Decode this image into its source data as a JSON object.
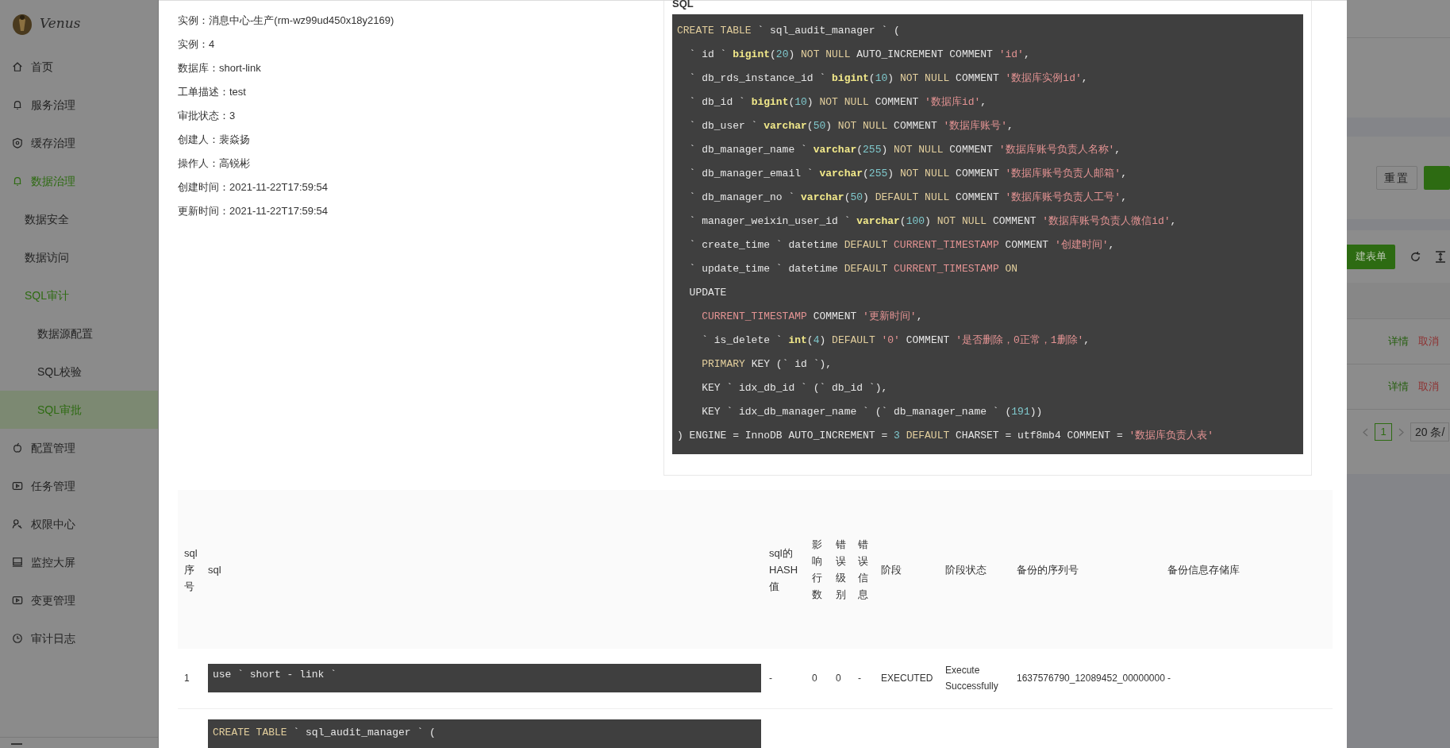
{
  "sidebar": {
    "logo_text": "Venus",
    "items": [
      {
        "label": "首页",
        "selected": false
      },
      {
        "label": "服务治理",
        "selected": false
      },
      {
        "label": "缓存治理",
        "selected": false
      },
      {
        "label": "数据治理",
        "selected": false,
        "expanded": true,
        "children": [
          {
            "label": "数据安全",
            "selected": false
          },
          {
            "label": "数据访问",
            "selected": false
          },
          {
            "label": "SQL审计",
            "selected": false,
            "expanded": true,
            "children": [
              {
                "label": "数据源配置",
                "selected": false
              },
              {
                "label": "SQL校验",
                "selected": false
              },
              {
                "label": "SQL审批",
                "selected": true
              }
            ]
          }
        ]
      },
      {
        "label": "配置管理",
        "selected": false
      },
      {
        "label": "任务管理",
        "selected": false
      },
      {
        "label": "权限中心",
        "selected": false
      },
      {
        "label": "监控大屏",
        "selected": false
      },
      {
        "label": "变更管理",
        "selected": false
      },
      {
        "label": "审计日志",
        "selected": false
      }
    ]
  },
  "modal": {
    "details": [
      "实例：消息中心-生产(rm-wz99ud450x18y2169)",
      "实例：4",
      "数据库：short-link",
      "工单描述：test",
      "审批状态：3",
      "创建人：裴焱扬",
      "操作人：高锐彬",
      "创建时间：2021-11-22T17:59:54",
      "更新时间：2021-11-22T17:59:54"
    ],
    "sql_card": {
      "title": "SQL",
      "lines": [
        [
          {
            "kind": "keyword",
            "text": "CREATE TABLE"
          },
          {
            "kind": "plain",
            "text": " ` sql_audit_manager ` ("
          }
        ],
        [
          {
            "kind": "plain",
            "text": "  ` id ` "
          },
          {
            "kind": "type",
            "text": "bigint"
          },
          {
            "kind": "plain",
            "text": "("
          },
          {
            "kind": "number",
            "text": "20"
          },
          {
            "kind": "plain",
            "text": ") "
          },
          {
            "kind": "keyword",
            "text": "NOT NULL"
          },
          {
            "kind": "plain",
            "text": " AUTO_INCREMENT COMMENT "
          },
          {
            "kind": "string",
            "text": "'id'"
          },
          {
            "kind": "plain",
            "text": ","
          }
        ],
        [
          {
            "kind": "plain",
            "text": "  ` db_rds_instance_id ` "
          },
          {
            "kind": "type",
            "text": "bigint"
          },
          {
            "kind": "plain",
            "text": "("
          },
          {
            "kind": "number",
            "text": "10"
          },
          {
            "kind": "plain",
            "text": ") "
          },
          {
            "kind": "keyword",
            "text": "NOT NULL"
          },
          {
            "kind": "plain",
            "text": " COMMENT "
          },
          {
            "kind": "string",
            "text": "'数据库实例id'"
          },
          {
            "kind": "plain",
            "text": ","
          }
        ],
        [
          {
            "kind": "plain",
            "text": "  ` db_id ` "
          },
          {
            "kind": "type",
            "text": "bigint"
          },
          {
            "kind": "plain",
            "text": "("
          },
          {
            "kind": "number",
            "text": "10"
          },
          {
            "kind": "plain",
            "text": ") "
          },
          {
            "kind": "keyword",
            "text": "NOT NULL"
          },
          {
            "kind": "plain",
            "text": " COMMENT "
          },
          {
            "kind": "string",
            "text": "'数据库id'"
          },
          {
            "kind": "plain",
            "text": ","
          }
        ],
        [
          {
            "kind": "plain",
            "text": "  ` db_user ` "
          },
          {
            "kind": "type",
            "text": "varchar"
          },
          {
            "kind": "plain",
            "text": "("
          },
          {
            "kind": "number",
            "text": "50"
          },
          {
            "kind": "plain",
            "text": ") "
          },
          {
            "kind": "keyword",
            "text": "NOT NULL"
          },
          {
            "kind": "plain",
            "text": " COMMENT "
          },
          {
            "kind": "string",
            "text": "'数据库账号'"
          },
          {
            "kind": "plain",
            "text": ","
          }
        ],
        [
          {
            "kind": "plain",
            "text": "  ` db_manager_name ` "
          },
          {
            "kind": "type",
            "text": "varchar"
          },
          {
            "kind": "plain",
            "text": "("
          },
          {
            "kind": "number",
            "text": "255"
          },
          {
            "kind": "plain",
            "text": ") "
          },
          {
            "kind": "keyword",
            "text": "NOT NULL"
          },
          {
            "kind": "plain",
            "text": " COMMENT "
          },
          {
            "kind": "string",
            "text": "'数据库账号负责人名称'"
          },
          {
            "kind": "plain",
            "text": ","
          }
        ],
        [
          {
            "kind": "plain",
            "text": "  ` db_manager_email ` "
          },
          {
            "kind": "type",
            "text": "varchar"
          },
          {
            "kind": "plain",
            "text": "("
          },
          {
            "kind": "number",
            "text": "255"
          },
          {
            "kind": "plain",
            "text": ") "
          },
          {
            "kind": "keyword",
            "text": "NOT NULL"
          },
          {
            "kind": "plain",
            "text": " COMMENT "
          },
          {
            "kind": "string",
            "text": "'数据库账号负责人邮箱'"
          },
          {
            "kind": "plain",
            "text": ","
          }
        ],
        [
          {
            "kind": "plain",
            "text": "  ` db_manager_no ` "
          },
          {
            "kind": "type",
            "text": "varchar"
          },
          {
            "kind": "plain",
            "text": "("
          },
          {
            "kind": "number",
            "text": "50"
          },
          {
            "kind": "plain",
            "text": ") "
          },
          {
            "kind": "keyword",
            "text": "DEFAULT NULL"
          },
          {
            "kind": "plain",
            "text": " COMMENT "
          },
          {
            "kind": "string",
            "text": "'数据库账号负责人工号'"
          },
          {
            "kind": "plain",
            "text": ","
          }
        ],
        [
          {
            "kind": "plain",
            "text": "  ` manager_weixin_user_id ` "
          },
          {
            "kind": "type",
            "text": "varchar"
          },
          {
            "kind": "plain",
            "text": "("
          },
          {
            "kind": "number",
            "text": "100"
          },
          {
            "kind": "plain",
            "text": ") "
          },
          {
            "kind": "keyword",
            "text": "NOT NULL"
          },
          {
            "kind": "plain",
            "text": " COMMENT "
          },
          {
            "kind": "string",
            "text": "'数据库账号负责人微信id'"
          },
          {
            "kind": "plain",
            "text": ","
          }
        ],
        [
          {
            "kind": "plain",
            "text": "  ` create_time ` datetime "
          },
          {
            "kind": "keyword",
            "text": "DEFAULT "
          },
          {
            "kind": "string",
            "text": "CURRENT_TIMESTAMP"
          },
          {
            "kind": "plain",
            "text": " COMMENT "
          },
          {
            "kind": "string",
            "text": "'创建时间'"
          },
          {
            "kind": "plain",
            "text": ","
          }
        ],
        [
          {
            "kind": "plain",
            "text": "  ` update_time ` datetime "
          },
          {
            "kind": "keyword",
            "text": "DEFAULT "
          },
          {
            "kind": "string",
            "text": "CURRENT_TIMESTAMP "
          },
          {
            "kind": "keyword",
            "text": "ON"
          }
        ],
        [
          {
            "kind": "plain",
            "text": "  UPDATE"
          }
        ],
        [
          {
            "kind": "string",
            "text": "    CURRENT_TIMESTAMP"
          },
          {
            "kind": "plain",
            "text": " COMMENT "
          },
          {
            "kind": "string",
            "text": "'更新时间'"
          },
          {
            "kind": "plain",
            "text": ","
          }
        ],
        [
          {
            "kind": "plain",
            "text": "    ` is_delete ` "
          },
          {
            "kind": "type",
            "text": "int"
          },
          {
            "kind": "plain",
            "text": "("
          },
          {
            "kind": "number",
            "text": "4"
          },
          {
            "kind": "plain",
            "text": ") "
          },
          {
            "kind": "keyword",
            "text": "DEFAULT "
          },
          {
            "kind": "string",
            "text": "'0'"
          },
          {
            "kind": "plain",
            "text": " COMMENT "
          },
          {
            "kind": "string",
            "text": "'是否删除，0正常，1删除'"
          },
          {
            "kind": "plain",
            "text": ","
          }
        ],
        [
          {
            "kind": "keyword",
            "text": "    PRIMARY"
          },
          {
            "kind": "plain",
            "text": " KEY (` id `),"
          }
        ],
        [
          {
            "kind": "plain",
            "text": "    KEY ` idx_db_id ` (` db_id `),"
          }
        ],
        [
          {
            "kind": "plain",
            "text": "    KEY ` idx_db_manager_name ` (` db_manager_name ` ("
          },
          {
            "kind": "number",
            "text": "191"
          },
          {
            "kind": "plain",
            "text": "))"
          }
        ],
        [
          {
            "kind": "plain",
            "text": ") ENGINE = InnoDB AUTO_INCREMENT = "
          },
          {
            "kind": "number",
            "text": "3 "
          },
          {
            "kind": "keyword",
            "text": "DEFAULT"
          },
          {
            "kind": "plain",
            "text": " CHARSET = utf8mb4 COMMENT = "
          },
          {
            "kind": "string",
            "text": "'数据库负责人表'"
          }
        ]
      ]
    },
    "table": {
      "columns": [
        "sql序号",
        "sql",
        "sql的HASH值",
        "影响行数",
        "错误级别",
        "错误信息",
        "阶段",
        "阶段状态",
        "备份的序列号",
        "备份信息存储库"
      ],
      "rows": [
        {
          "seq": "1",
          "sql_lines": [
            [
              {
                "kind": "plain",
                "text": "use ` short - link `"
              }
            ]
          ],
          "hash": "-",
          "affected_rows": "0",
          "error_level": "0",
          "error_message": "-",
          "stage": "EXECUTED",
          "stage_status": "Execute Successfully",
          "backup_sequence": "1637576790_12089452_00000000",
          "backup_db": "-"
        },
        {
          "sql_lines": [
            [
              {
                "kind": "keyword",
                "text": "CREATE TABLE"
              },
              {
                "kind": "plain",
                "text": " ` sql_audit_manager ` ("
              }
            ]
          ]
        }
      ]
    }
  },
  "background_page": {
    "reset_button": "重置",
    "create_button": "建表单",
    "rows": [
      {
        "detail_link": "详情",
        "cancel_link": "取消"
      },
      {
        "detail_link": "详情",
        "cancel_link": "取消"
      }
    ],
    "pagination": {
      "pages": [
        {
          "label": "1",
          "selected": true
        }
      ],
      "page_size": "20 条/"
    }
  }
}
